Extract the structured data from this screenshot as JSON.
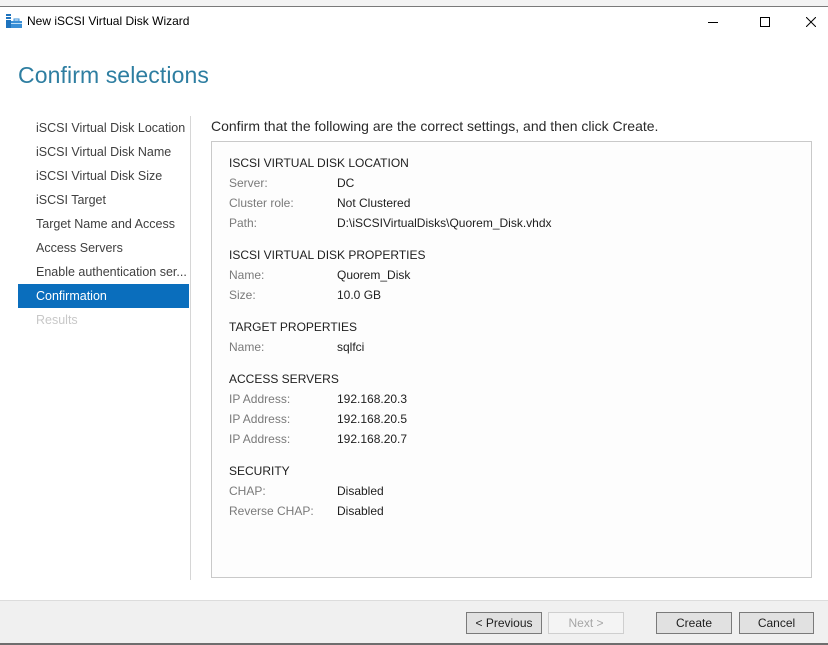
{
  "window": {
    "title": "New iSCSI Virtual Disk Wizard",
    "icon": "iscsi-wizard-icon",
    "controls": {
      "minimize": "minimize-icon",
      "maximize": "maximize-icon",
      "close": "close-icon"
    }
  },
  "page": {
    "title": "Confirm selections",
    "instruction": "Confirm that the following are the correct settings, and then click Create."
  },
  "nav": {
    "items": [
      {
        "label": "iSCSI Virtual Disk Location",
        "state": "normal"
      },
      {
        "label": "iSCSI Virtual Disk Name",
        "state": "normal"
      },
      {
        "label": "iSCSI Virtual Disk Size",
        "state": "normal"
      },
      {
        "label": "iSCSI Target",
        "state": "normal"
      },
      {
        "label": "Target Name and Access",
        "state": "normal"
      },
      {
        "label": "Access Servers",
        "state": "normal"
      },
      {
        "label": "Enable authentication ser...",
        "state": "normal"
      },
      {
        "label": "Confirmation",
        "state": "active"
      },
      {
        "label": "Results",
        "state": "disabled"
      }
    ]
  },
  "summary": {
    "sections": [
      {
        "heading": "ISCSI VIRTUAL DISK LOCATION",
        "rows": [
          {
            "label": "Server:",
            "value": "DC"
          },
          {
            "label": "Cluster role:",
            "value": "Not Clustered"
          },
          {
            "label": "Path:",
            "value": "D:\\iSCSIVirtualDisks\\Quorem_Disk.vhdx"
          }
        ]
      },
      {
        "heading": "ISCSI VIRTUAL DISK PROPERTIES",
        "rows": [
          {
            "label": "Name:",
            "value": "Quorem_Disk"
          },
          {
            "label": "Size:",
            "value": "10.0 GB"
          }
        ]
      },
      {
        "heading": "TARGET PROPERTIES",
        "rows": [
          {
            "label": "Name:",
            "value": "sqlfci"
          }
        ]
      },
      {
        "heading": "ACCESS SERVERS",
        "rows": [
          {
            "label": "IP Address:",
            "value": "192.168.20.3"
          },
          {
            "label": "IP Address:",
            "value": "192.168.20.5"
          },
          {
            "label": "IP Address:",
            "value": "192.168.20.7"
          }
        ]
      },
      {
        "heading": "SECURITY",
        "rows": [
          {
            "label": "CHAP:",
            "value": "Disabled"
          },
          {
            "label": "Reverse CHAP:",
            "value": "Disabled"
          }
        ]
      }
    ]
  },
  "buttons": {
    "previous": "< Previous",
    "next": "Next >",
    "create": "Create",
    "cancel": "Cancel"
  },
  "colors": {
    "accent": "#0a6ebd",
    "title": "#2e7ea1"
  }
}
